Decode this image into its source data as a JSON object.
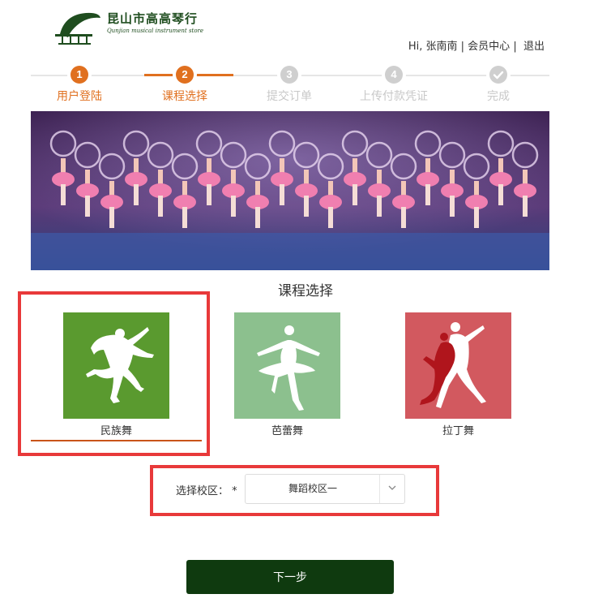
{
  "header": {
    "logo_title": "昆山市高高琴行",
    "logo_subtitle": "Qunjian musical instrument store",
    "user_greeting": "Hi, 张南南",
    "member_center": "会员中心",
    "logout": "退出",
    "separator": "|"
  },
  "steps": [
    {
      "number": "1",
      "label": "用户登陆",
      "state": "done"
    },
    {
      "number": "2",
      "label": "课程选择",
      "state": "current"
    },
    {
      "number": "3",
      "label": "提交订单",
      "state": "pending"
    },
    {
      "number": "4",
      "label": "上传付款凭证",
      "state": "pending"
    },
    {
      "icon": "check-icon",
      "label": "完成",
      "state": "pending"
    }
  ],
  "section": {
    "title": "课程选择"
  },
  "courses": [
    {
      "name": "民族舞",
      "icon": "folk-dancer-icon",
      "color": "#5a9a2f",
      "selected": true
    },
    {
      "name": "芭蕾舞",
      "icon": "ballerina-icon",
      "color": "#8cc08e",
      "selected": false
    },
    {
      "name": "拉丁舞",
      "icon": "latin-dancers-icon",
      "color": "#d2595f",
      "selected": false
    }
  ],
  "campus": {
    "label": "选择校区：",
    "required_mark": "*",
    "selected": "舞蹈校区一"
  },
  "actions": {
    "next": "下一步"
  },
  "colors": {
    "accent": "#e0701f",
    "button": "#0f3a0f",
    "highlight": "#e8393a"
  }
}
